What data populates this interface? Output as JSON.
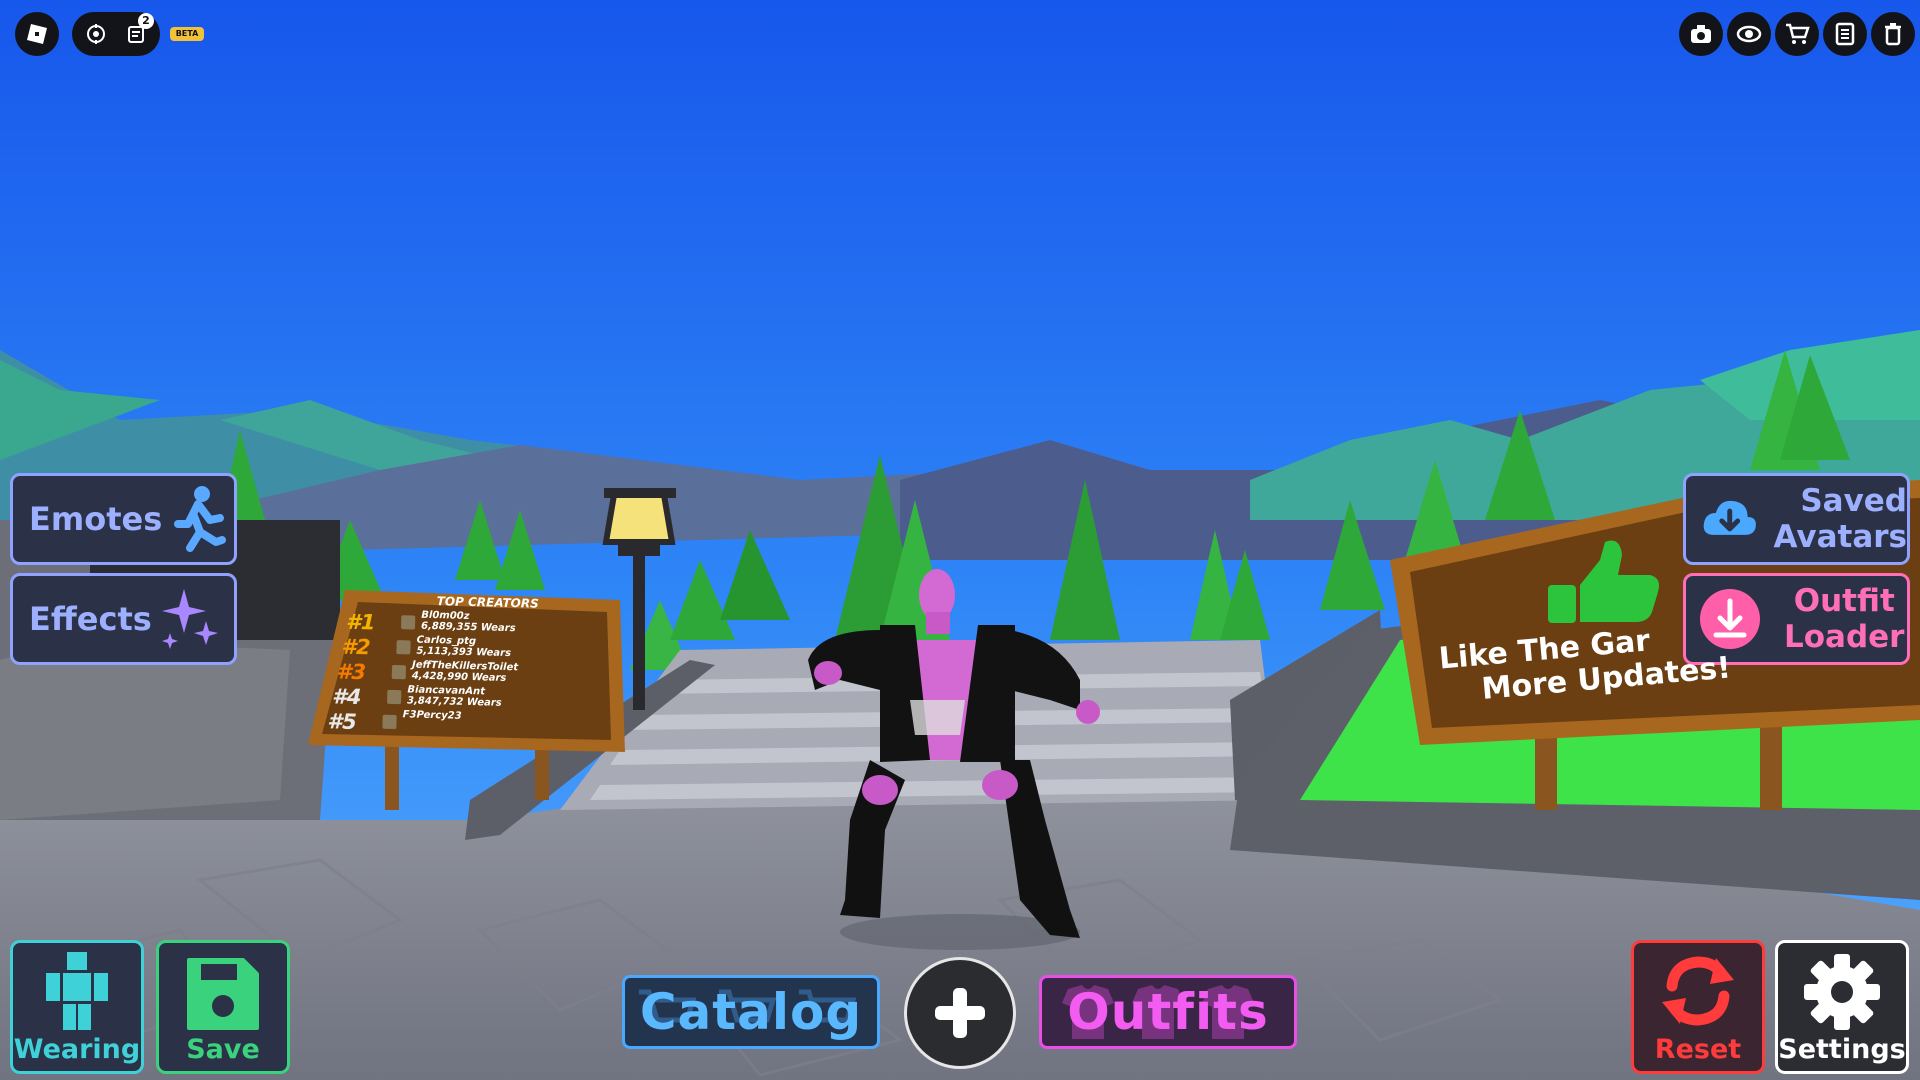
{
  "topbar": {
    "notification_count": "2",
    "beta_label": "BETA"
  },
  "right_icons": [
    "camera-icon",
    "eye-icon",
    "cart-icon",
    "list-icon",
    "trash-icon"
  ],
  "left_panels": {
    "emotes_label": "Emotes",
    "effects_label": "Effects"
  },
  "right_panels": {
    "saved_avatars_line1": "Saved",
    "saved_avatars_line2": "Avatars",
    "outfit_loader_line1": "Outfit",
    "outfit_loader_line2": "Loader"
  },
  "bottom": {
    "wearing_label": "Wearing",
    "save_label": "Save",
    "catalog_label": "Catalog",
    "outfits_label": "Outfits",
    "reset_label": "Reset",
    "settings_label": "Settings"
  },
  "leaderboard": {
    "title": "TOP CREATORS",
    "entries": [
      {
        "rank": "#1",
        "name": "Bl0m00z",
        "wears": "6,889,355 Wears"
      },
      {
        "rank": "#2",
        "name": "Carlos_ptg",
        "wears": "5,113,393 Wears"
      },
      {
        "rank": "#3",
        "name": "JeffTheKillersToilet",
        "wears": "4,428,990 Wears"
      },
      {
        "rank": "#4",
        "name": "BiancavanAnt",
        "wears": "3,847,732 Wears"
      },
      {
        "rank": "#5",
        "name": "F3Percy23",
        "wears": ""
      }
    ]
  },
  "like_sign": {
    "line1": "Like The Gar",
    "line2": "More Updates!"
  },
  "colors": {
    "sky_top": "#1757ec",
    "sky_bottom": "#5ab0ff",
    "panel_bg": "#2b3247",
    "panel_border": "#8fa2ff",
    "wearing": "#3fd1d8",
    "save": "#3bd27e",
    "catalog": "#4aa8ff",
    "outfits": "#e84fe6",
    "reset": "#ff3b3b",
    "settings": "#ffffff"
  }
}
